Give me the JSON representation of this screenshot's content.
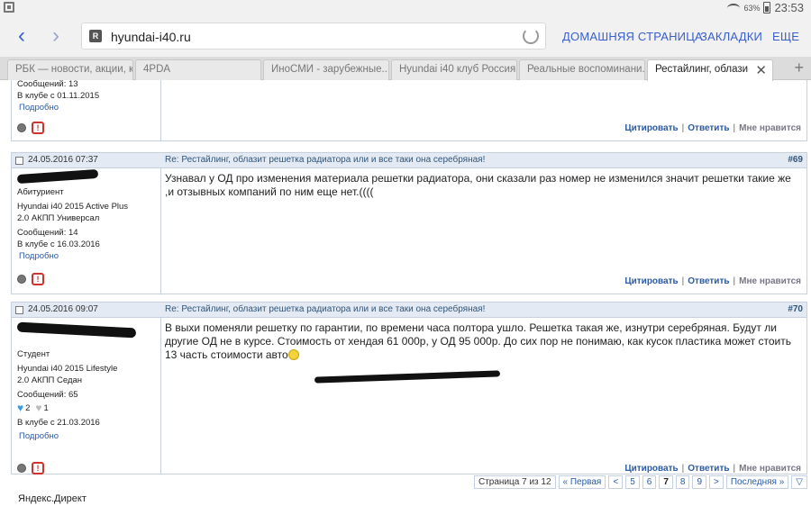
{
  "status": {
    "battery": "63%",
    "time": "23:53"
  },
  "browser": {
    "url": "hyundai-i40.ru",
    "menu": [
      "ДОМАШНЯЯ СТРАНИЦА",
      "ЗАКЛАДКИ",
      "ЕЩЕ"
    ],
    "tabs": [
      "РБК — новости, акции, к...",
      "4PDA",
      "ИноСМИ - зарубежные...",
      "Hyundai i40 клуб Россия...",
      "Реальные воспоминани...",
      "Рестайлинг, облази"
    ]
  },
  "post_top": {
    "messages": "Сообщений: 13",
    "joined": "В клубе с 01.11.2015",
    "more": "Подробно"
  },
  "post69": {
    "date": "24.05.2016 07:37",
    "title": "Re: Рестайлинг, облазит решетка радиатора или и все таки она серебряная!",
    "num": "#69",
    "rank": "Абитуриент",
    "car1": "Hyundai i40 2015 Active Plus",
    "car2": "2.0 АКПП Универсал",
    "messages": "Сообщений: 14",
    "joined": "В клубе с 16.03.2016",
    "more": "Подробно",
    "text": "Узнавал у ОД про изменения материала решетки радиатора, они сказали раз номер не изменился значит решетки такие же ,и отзывных компаний по ним еще нет.(((("
  },
  "post70": {
    "date": "24.05.2016 09:07",
    "title": "Re: Рестайлинг, облазит решетка радиатора или и все таки она серебряная!",
    "num": "#70",
    "rank": "Студент",
    "car1": "Hyundai i40 2015 Lifestyle",
    "car2": "2.0 АКПП Седан",
    "messages": "Сообщений: 65",
    "likes": "2",
    "dislikes": "1",
    "joined": "В клубе с 21.03.2016",
    "more": "Подробно",
    "text": "В выхи поменяли решетку по гарантии, по времени часа полтора ушло. Решетка такая же, изнутри серебряная. Будут ли другие ОД не в курсе. Стоимость от хендая 61 000р, у ОД 95 000р. До сих пор не понимаю, как кусок пластика может стоить 13 часть стоимости авто"
  },
  "actions": {
    "quote": "Цитировать",
    "reply": "Ответить",
    "like": "Мне нравится"
  },
  "pager": {
    "info": "Страница 7 из 12",
    "first": "« Первая",
    "prev": "<",
    "pages": [
      "5",
      "6",
      "7",
      "8",
      "9"
    ],
    "next": ">",
    "last": "Последняя »"
  },
  "footer": "Яндекс.Директ"
}
